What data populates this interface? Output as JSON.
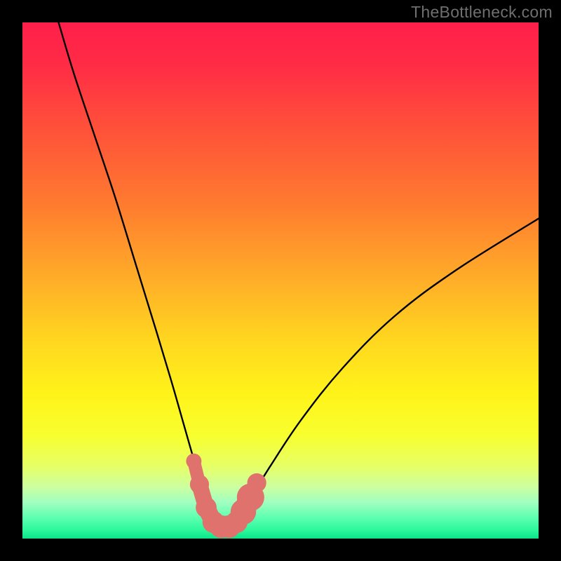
{
  "watermark": "TheBottleneck.com",
  "colors": {
    "frame": "#000000",
    "curve": "#000000",
    "marker_fill": "#e0726e",
    "marker_stroke": "#d15a56",
    "gradient_stops": [
      {
        "offset": 0.0,
        "color": "#ff1f4a"
      },
      {
        "offset": 0.08,
        "color": "#ff2b46"
      },
      {
        "offset": 0.2,
        "color": "#ff4f3a"
      },
      {
        "offset": 0.35,
        "color": "#ff7a2f"
      },
      {
        "offset": 0.5,
        "color": "#ffae28"
      },
      {
        "offset": 0.62,
        "color": "#ffd81f"
      },
      {
        "offset": 0.72,
        "color": "#fff31a"
      },
      {
        "offset": 0.8,
        "color": "#f8ff2e"
      },
      {
        "offset": 0.86,
        "color": "#e6ff66"
      },
      {
        "offset": 0.9,
        "color": "#ccffa0"
      },
      {
        "offset": 0.93,
        "color": "#a0ffc0"
      },
      {
        "offset": 0.96,
        "color": "#5cffb0"
      },
      {
        "offset": 0.985,
        "color": "#28f79a"
      },
      {
        "offset": 1.0,
        "color": "#0de48a"
      }
    ]
  },
  "chart_data": {
    "type": "line",
    "title": "",
    "xlabel": "",
    "ylabel": "",
    "xlim": [
      0,
      100
    ],
    "ylim": [
      0,
      100
    ],
    "series": [
      {
        "name": "bottleneck-curve",
        "x": [
          7,
          10,
          14,
          18,
          22,
          26,
          29,
          31,
          33,
          34.5,
          36,
          37.5,
          39,
          40.5,
          42,
          44,
          48,
          54,
          62,
          72,
          84,
          100
        ],
        "y": [
          100,
          90,
          78,
          66,
          53,
          40,
          30,
          23,
          16,
          11,
          7,
          4,
          2.5,
          2.5,
          4,
          7.5,
          14,
          23,
          33,
          43,
          52,
          62
        ]
      }
    ],
    "markers": [
      {
        "x": 33.2,
        "y": 15.0,
        "r": 1.2
      },
      {
        "x": 34.3,
        "y": 10.5,
        "r": 1.6
      },
      {
        "x": 35.6,
        "y": 6.0,
        "r": 1.8
      },
      {
        "x": 37.0,
        "y": 3.2,
        "r": 1.9
      },
      {
        "x": 38.5,
        "y": 2.3,
        "r": 2.0
      },
      {
        "x": 40.0,
        "y": 2.3,
        "r": 2.0
      },
      {
        "x": 41.5,
        "y": 3.2,
        "r": 1.9
      },
      {
        "x": 42.8,
        "y": 5.2,
        "r": 2.3
      },
      {
        "x": 44.2,
        "y": 8.0,
        "r": 2.5
      },
      {
        "x": 45.4,
        "y": 10.8,
        "r": 1.6
      }
    ]
  }
}
